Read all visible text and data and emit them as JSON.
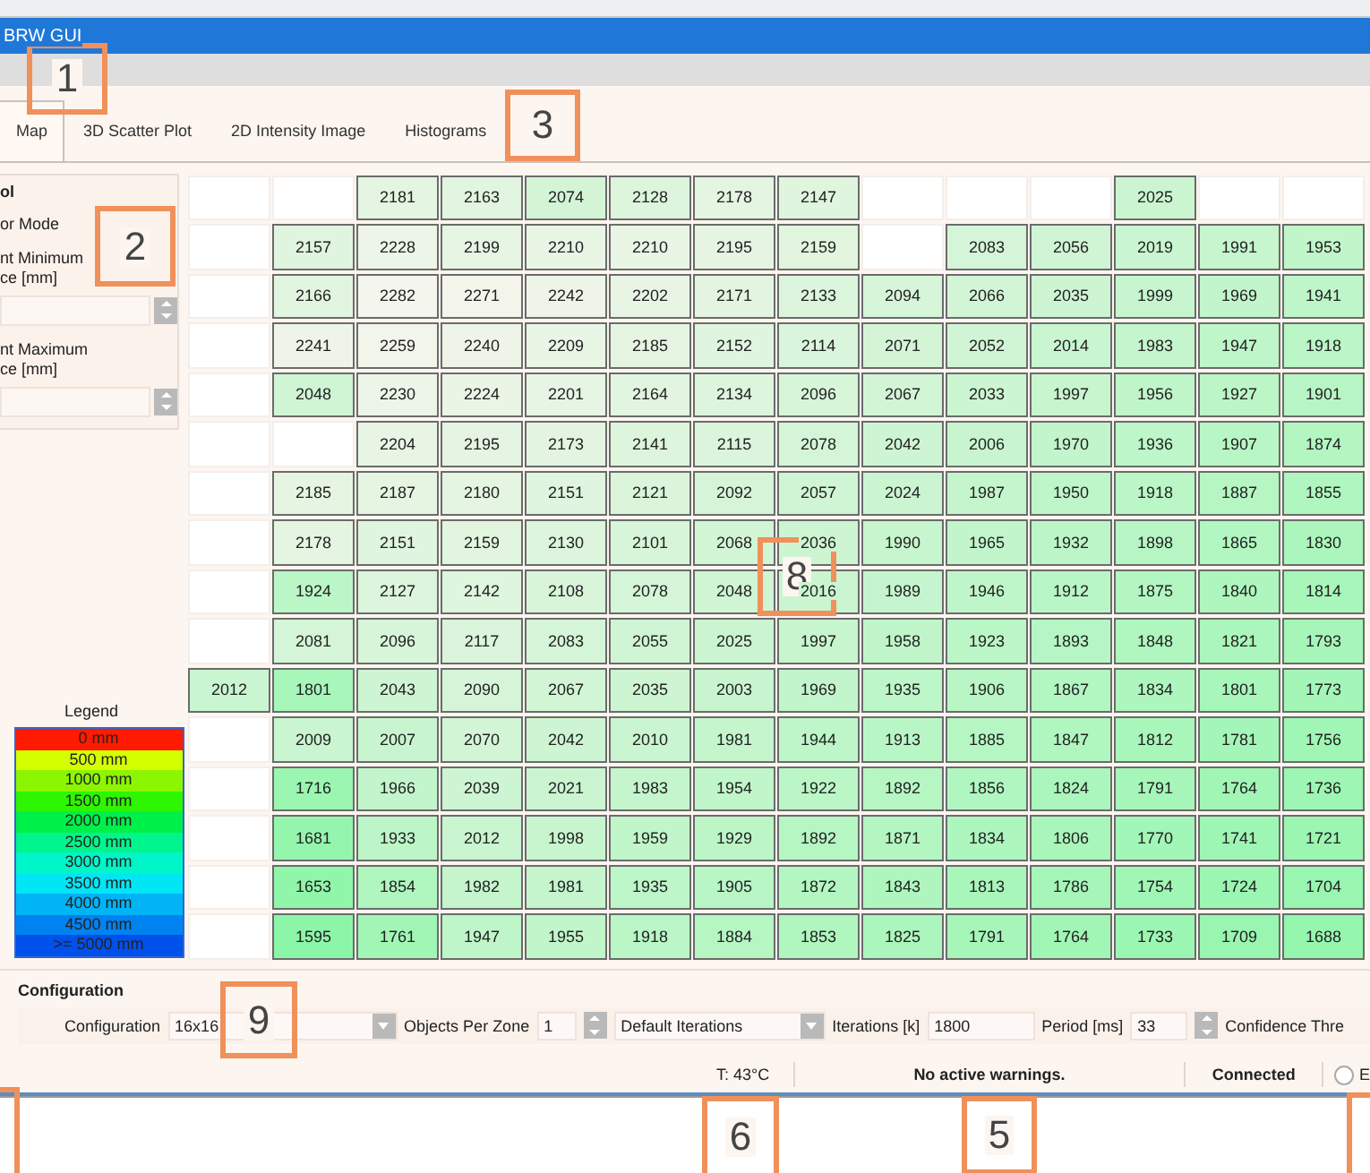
{
  "window": {
    "title": "BRW GUI"
  },
  "tabs": [
    {
      "label": "Map",
      "selected": true
    },
    {
      "label": "3D Scatter Plot",
      "selected": false
    },
    {
      "label": "2D Intensity Image",
      "selected": false
    },
    {
      "label": "Histograms",
      "selected": false
    }
  ],
  "control_panel": {
    "title": "ol",
    "mode_label": "or Mode",
    "fields": [
      {
        "label_1": "nt Minimum",
        "label_2": "ce [mm]"
      },
      {
        "label_1": "nt Maximum",
        "label_2": "ce [mm]"
      }
    ]
  },
  "legend": {
    "title": "Legend",
    "items": [
      {
        "label": "0 mm",
        "color": "#ff1a00"
      },
      {
        "label": "500 mm",
        "color": "#d4ff00"
      },
      {
        "label": "1000 mm",
        "color": "#8cf500"
      },
      {
        "label": "1500 mm",
        "color": "#2ef500"
      },
      {
        "label": "2000 mm",
        "color": "#00f04a"
      },
      {
        "label": "2500 mm",
        "color": "#00f58c"
      },
      {
        "label": "3000 mm",
        "color": "#00f5c8"
      },
      {
        "label": "3500 mm",
        "color": "#00e6f5"
      },
      {
        "label": "4000 mm",
        "color": "#00b4f5"
      },
      {
        "label": "4500 mm",
        "color": "#0082f0"
      },
      {
        "label": ">= 5000 mm",
        "color": "#0050eb"
      }
    ]
  },
  "distance_grid": {
    "rows": [
      [
        null,
        null,
        "2181",
        "2163",
        "2074",
        "2128",
        "2178",
        "2147",
        null,
        null,
        null,
        "2025",
        null,
        null
      ],
      [
        null,
        "2157",
        "2228",
        "2199",
        "2210",
        "2210",
        "2195",
        "2159",
        null,
        "2083",
        "2056",
        "2019",
        "1991",
        "1953"
      ],
      [
        null,
        "2166",
        "2282",
        "2271",
        "2242",
        "2202",
        "2171",
        "2133",
        "2094",
        "2066",
        "2035",
        "1999",
        "1969",
        "1941"
      ],
      [
        null,
        "2241",
        "2259",
        "2240",
        "2209",
        "2185",
        "2152",
        "2114",
        "2071",
        "2052",
        "2014",
        "1983",
        "1947",
        "1918"
      ],
      [
        null,
        "2048",
        "2230",
        "2224",
        "2201",
        "2164",
        "2134",
        "2096",
        "2067",
        "2033",
        "1997",
        "1956",
        "1927",
        "1901"
      ],
      [
        null,
        null,
        "2204",
        "2195",
        "2173",
        "2141",
        "2115",
        "2078",
        "2042",
        "2006",
        "1970",
        "1936",
        "1907",
        "1874"
      ],
      [
        null,
        "2185",
        "2187",
        "2180",
        "2151",
        "2121",
        "2092",
        "2057",
        "2024",
        "1987",
        "1950",
        "1918",
        "1887",
        "1855"
      ],
      [
        null,
        "2178",
        "2151",
        "2159",
        "2130",
        "2101",
        "2068",
        "2036",
        "1990",
        "1965",
        "1932",
        "1898",
        "1865",
        "1830"
      ],
      [
        null,
        "1924",
        "2127",
        "2142",
        "2108",
        "2078",
        "2048",
        "2016",
        "1989",
        "1946",
        "1912",
        "1875",
        "1840",
        "1814"
      ],
      [
        null,
        "2081",
        "2096",
        "2117",
        "2083",
        "2055",
        "2025",
        "1997",
        "1958",
        "1923",
        "1893",
        "1848",
        "1821",
        "1793"
      ],
      [
        "2012",
        "1801",
        "2043",
        "2090",
        "2067",
        "2035",
        "2003",
        "1969",
        "1935",
        "1906",
        "1867",
        "1834",
        "1801",
        "1773"
      ],
      [
        null,
        "2009",
        "2007",
        "2070",
        "2042",
        "2010",
        "1981",
        "1944",
        "1913",
        "1885",
        "1847",
        "1812",
        "1781",
        "1756"
      ],
      [
        null,
        "1716",
        "1966",
        "2039",
        "2021",
        "1983",
        "1954",
        "1922",
        "1892",
        "1856",
        "1824",
        "1791",
        "1764",
        "1736"
      ],
      [
        null,
        "1681",
        "1933",
        "2012",
        "1998",
        "1959",
        "1929",
        "1892",
        "1871",
        "1834",
        "1806",
        "1770",
        "1741",
        "1721"
      ],
      [
        null,
        "1653",
        "1854",
        "1982",
        "1981",
        "1935",
        "1905",
        "1872",
        "1843",
        "1813",
        "1786",
        "1754",
        "1724",
        "1704"
      ],
      [
        null,
        "1595",
        "1761",
        "1947",
        "1955",
        "1918",
        "1884",
        "1853",
        "1825",
        "1791",
        "1764",
        "1733",
        "1709",
        "1688"
      ]
    ]
  },
  "configuration": {
    "title": "Configuration",
    "label": "Configuration",
    "value": "16x16",
    "objects_label": "Objects Per Zone",
    "objects_value": "1",
    "iterations_mode": "Default Iterations",
    "iterations_label": "Iterations [k]",
    "iterations_value": "1800",
    "period_label": "Period [ms]",
    "period_value": "33",
    "confidence_label": "Confidence Thre"
  },
  "status_bar": {
    "temperature": "T: 43°C",
    "warnings": "No active warnings.",
    "connection": "Connected",
    "option": "E",
    "option_selected": false
  },
  "callouts": [
    {
      "kind": "numbered",
      "label": "1"
    },
    {
      "kind": "numbered",
      "label": "2"
    },
    {
      "kind": "numbered",
      "label": "3"
    },
    {
      "kind": "numbered",
      "label": "8"
    },
    {
      "kind": "numbered",
      "label": "9"
    },
    {
      "kind": "numbered",
      "label": "6"
    },
    {
      "kind": "numbered",
      "label": "5"
    },
    {
      "kind": "cut"
    },
    {
      "kind": "cut"
    }
  ]
}
